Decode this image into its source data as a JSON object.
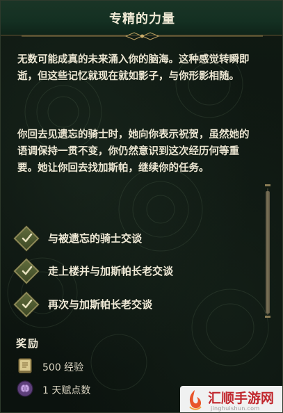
{
  "header": {
    "title": "专精的力量"
  },
  "description": {
    "paragraph1": "无数可能成真的未来涌入你的脑海。这种感觉转瞬即逝，但这些记忆就现在就如影子，与你形影相随。",
    "paragraph2": "你回去见遗忘的骑士时，她向你表示祝贺，虽然她的语调保持一贯不变，你仍然意识到这次经历何等重要。她让你回去找加斯帕，继续你的任务。"
  },
  "objectives": [
    {
      "label": "与被遗忘的骑士交谈",
      "completed": true
    },
    {
      "label": "走上楼并与加斯帕长老交谈",
      "completed": true
    },
    {
      "label": "再次与加斯帕长老交谈",
      "completed": true
    }
  ],
  "rewards": {
    "title": "奖励",
    "items": [
      {
        "icon": "experience-book-icon",
        "text": "500 经验"
      },
      {
        "icon": "talent-brain-icon",
        "text": "1 天赋点数"
      }
    ]
  },
  "watermark": {
    "title": "汇顺手游网",
    "url": "jinghuishun.com"
  },
  "colors": {
    "header_bg": "#153022",
    "panel_bg": "#0d1510",
    "text": "#ece6d2",
    "check_fill": "#4f5a30",
    "gold": "#8e8a58",
    "watermark_red": "#c1272d"
  }
}
